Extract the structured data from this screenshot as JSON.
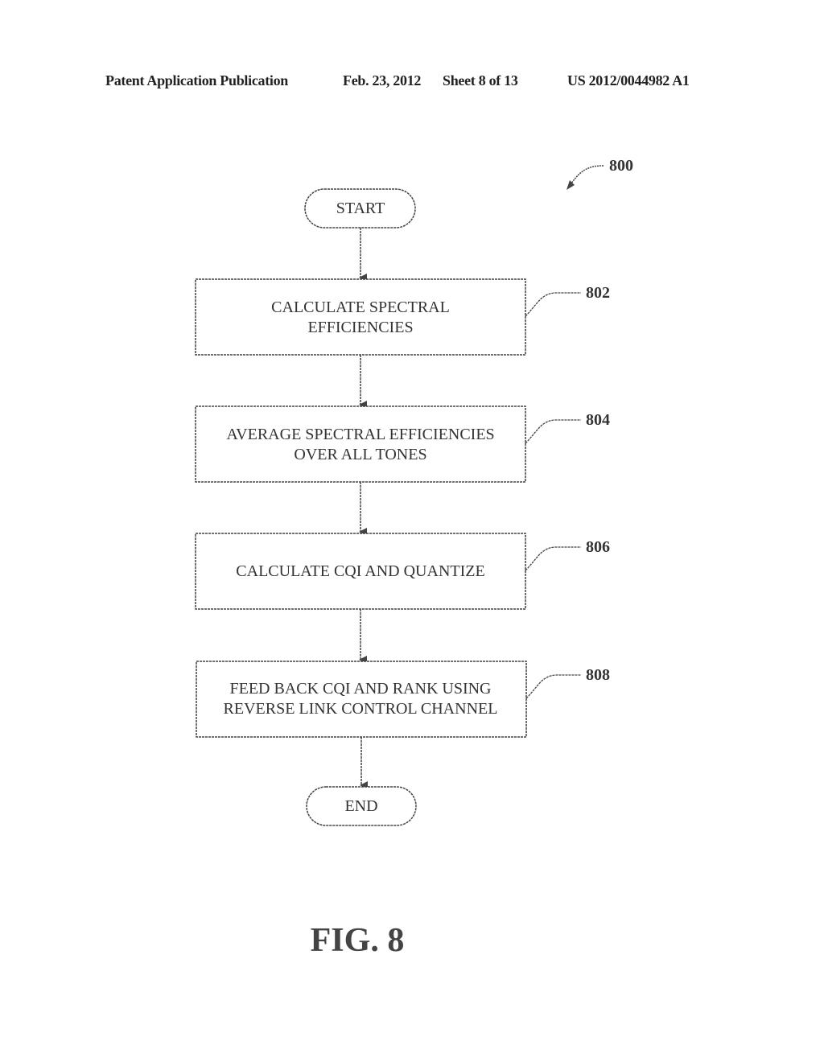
{
  "header": {
    "publication": "Patent Application Publication",
    "date": "Feb. 23, 2012",
    "sheet": "Sheet 8 of 13",
    "number": "US 2012/0044982 A1"
  },
  "diagram": {
    "ref": "800",
    "start": "START",
    "end": "END",
    "steps": [
      {
        "ref": "802",
        "lines": [
          "CALCULATE SPECTRAL",
          "EFFICIENCIES"
        ]
      },
      {
        "ref": "804",
        "lines": [
          "AVERAGE SPECTRAL EFFICIENCIES",
          "OVER ALL TONES"
        ]
      },
      {
        "ref": "806",
        "lines": [
          "CALCULATE CQI AND QUANTIZE"
        ]
      },
      {
        "ref": "808",
        "lines": [
          "FEED BACK CQI AND RANK USING",
          "REVERSE LINK CONTROL CHANNEL"
        ]
      }
    ],
    "figure_label": "FIG. 8"
  }
}
